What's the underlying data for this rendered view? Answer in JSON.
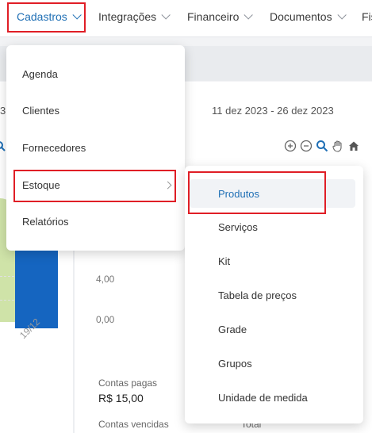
{
  "nav": {
    "items": [
      {
        "label": "Cadastros",
        "active": true
      },
      {
        "label": "Integrações",
        "active": false
      },
      {
        "label": "Financeiro",
        "active": false
      },
      {
        "label": "Documentos",
        "active": false
      },
      {
        "label": "Fis",
        "active": false
      }
    ]
  },
  "dashboard": {
    "date_range": "11 dez 2023 - 26 dez 2023",
    "partial_left_char": "3",
    "y_ticks": [
      "4,00",
      "0,00"
    ],
    "x_tick": "19/12",
    "stats": {
      "paid_label": "Contas pagas",
      "paid_value": "R$ 15,00",
      "overdue_label": "Contas vencidas",
      "total_label": "Total"
    },
    "colors": {
      "accent": "#1f6fb5",
      "bar": "#1565c0",
      "area": "#cfe3a8",
      "highlight": "#e01e26"
    }
  },
  "cadastros_menu": {
    "items": [
      "Agenda",
      "Clientes",
      "Fornecedores",
      "Estoque",
      "Relatórios"
    ],
    "submenu_parent": "Estoque"
  },
  "estoque_submenu": {
    "items": [
      "Produtos",
      "Serviços",
      "Kit",
      "Tabela de preços",
      "Grade",
      "Grupos",
      "Unidade de medida"
    ],
    "selected": "Produtos"
  }
}
